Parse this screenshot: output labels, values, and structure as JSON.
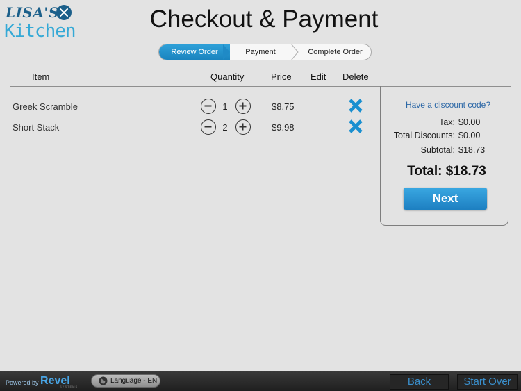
{
  "logo": {
    "line1": "LISA'S",
    "line2": "Kitchen"
  },
  "page_title": "Checkout & Payment",
  "steps": [
    "Review Order",
    "Payment",
    "Complete Order"
  ],
  "table": {
    "headers": {
      "item": "Item",
      "quantity": "Quantity",
      "price": "Price",
      "edit": "Edit",
      "delete": "Delete"
    },
    "rows": [
      {
        "name": "Greek Scramble",
        "quantity": "1",
        "price": "$8.75"
      },
      {
        "name": "Short Stack",
        "quantity": "2",
        "price": "$9.98"
      }
    ]
  },
  "summary": {
    "discount_link": "Have a discount code?",
    "tax_label": "Tax:",
    "tax_value": "$0.00",
    "discounts_label": "Total Discounts:",
    "discounts_value": "$0.00",
    "subtotal_label": "Subtotal:",
    "subtotal_value": "$18.73",
    "total": "Total: $18.73",
    "next_label": "Next"
  },
  "footer": {
    "powered_by": "Powered by",
    "brand": "Revel",
    "brand_sub": "SYSTEMS",
    "language": "Language - EN",
    "back_label": "Back",
    "start_over_label": "Start Over"
  },
  "colors": {
    "accent": "#1d84c4",
    "delete": "#1a8fd0",
    "background": "#e3e3e3"
  }
}
